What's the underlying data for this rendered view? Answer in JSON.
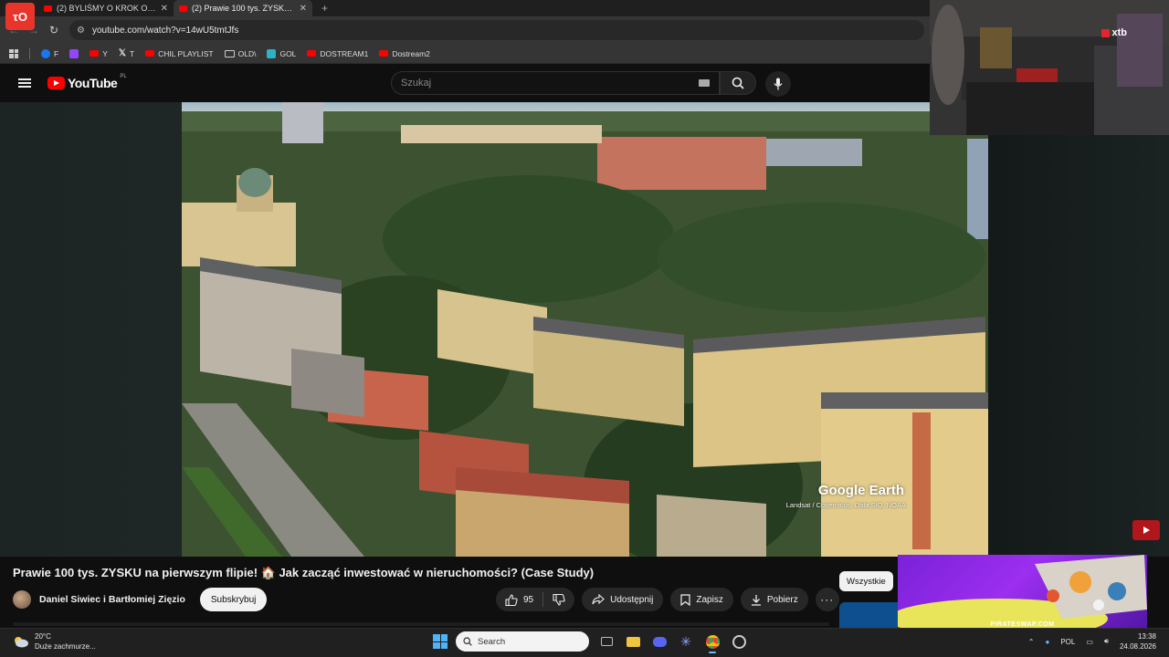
{
  "browser": {
    "tabs": [
      {
        "label": "(2) BYLIŚMY O KROK OD WOJN",
        "active": false
      },
      {
        "label": "(2) Prawie 100 tys. ZYSKU na pi",
        "active": true
      }
    ],
    "stream_logo": "τO",
    "url": "youtube.com/watch?v=14wU5tmtJfs",
    "bookmarks": [
      {
        "label": "F",
        "color": "#1877f2"
      },
      {
        "label": "",
        "color": "#9146ff"
      },
      {
        "label": "Y",
        "color": "#ff0000"
      },
      {
        "label": "T",
        "color": "#ffffff"
      },
      {
        "label": "CHIL PLAYLIST",
        "color": "#ff0000"
      },
      {
        "label": "OLD\\",
        "color": "#cccccc"
      },
      {
        "label": "GOL",
        "color": "#2db3c7"
      },
      {
        "label": "DOSTREAM1",
        "color": "#ff0000"
      },
      {
        "label": "Dostream2",
        "color": "#ff0000"
      }
    ]
  },
  "youtube": {
    "logo_text": "YouTube",
    "country": "PL",
    "search_placeholder": "Szukaj"
  },
  "video": {
    "watermark": "Google Earth",
    "credit": "Landsat / Copernicus, Data SIO, NOAA"
  },
  "webcam": {
    "sponsor": "xtb"
  },
  "meta": {
    "title": "Prawie 100 tys. ZYSKU na pierwszym flipie! 🏠 Jak zacząć inwestować w nieruchomości? (Case Study)",
    "channel": "Daniel Siwiec i Bartłomiej Zięzio",
    "subscribe": "Subskrybuj",
    "likes": "95",
    "share": "Udostępnij",
    "save": "Zapisz",
    "download": "Pobierz",
    "chip_all": "Wszystkie"
  },
  "ad": {
    "text": "PIRATESWAP.COM"
  },
  "taskbar": {
    "temperature": "20°C",
    "weather": "Duże zachmurze...",
    "search": "Search",
    "language": "POL",
    "time": "13:38",
    "date": "24.08.2026"
  },
  "colors": {
    "yt_red": "#ff0000",
    "background": "#0f0f0f",
    "pill": "#272727"
  }
}
